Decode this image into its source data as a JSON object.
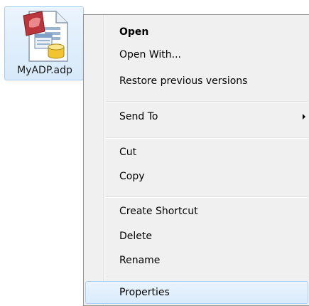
{
  "desktop": {
    "file": {
      "name": "MyADP.adp",
      "icon": "access-project-file-icon"
    }
  },
  "context_menu": {
    "items": [
      {
        "label": "Open",
        "bold": true
      },
      {
        "label": "Open With..."
      },
      {
        "label": "Restore previous versions"
      },
      {
        "label": "Send To",
        "has_submenu": true
      },
      {
        "label": "Cut"
      },
      {
        "label": "Copy"
      },
      {
        "label": "Create Shortcut"
      },
      {
        "label": "Delete"
      },
      {
        "label": "Rename"
      },
      {
        "label": "Properties",
        "highlighted": true
      }
    ]
  },
  "colors": {
    "menu_background": "#f0f0f0",
    "highlight_fill": "#d9ebfb",
    "highlight_border": "#aecff7",
    "selection_fill": "#d7e9fa",
    "access_brand": "#a4373a"
  }
}
